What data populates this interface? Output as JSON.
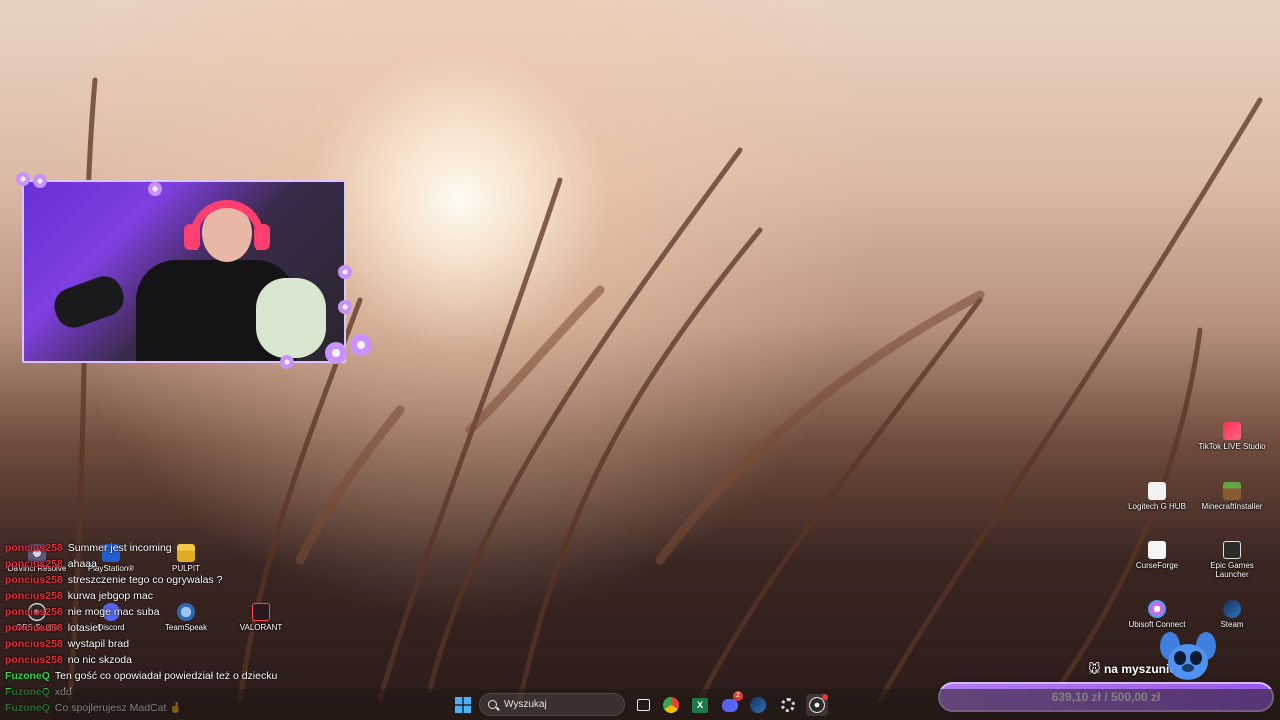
{
  "chat": [
    {
      "user": "poncius258",
      "user_color": "red",
      "message": "Summer jest incoming"
    },
    {
      "user": "poncius258",
      "user_color": "red",
      "message": "ahaaa"
    },
    {
      "user": "poncius258",
      "user_color": "red",
      "message": "streszczenie tego co ogrywalas ?"
    },
    {
      "user": "poncius258",
      "user_color": "red",
      "message": "kurwa jebgop mac"
    },
    {
      "user": "poncius258",
      "user_color": "red",
      "message": "nie moge mac suba"
    },
    {
      "user": "poncius258",
      "user_color": "red",
      "message": "lotasiet"
    },
    {
      "user": "poncius258",
      "user_color": "red",
      "message": "wystapil brad"
    },
    {
      "user": "poncius258",
      "user_color": "red",
      "message": "no nic skzoda"
    },
    {
      "user": "FuzoneQ",
      "user_color": "green",
      "message": "Ten gość co opowiadał powiedział też o dziecku"
    },
    {
      "user": "FuzoneQ",
      "user_color": "green",
      "message": "xdd"
    },
    {
      "user": "FuzoneQ",
      "user_color": "green",
      "message": "Co spojlerujesz MadCat 🤞"
    }
  ],
  "desktop_icons": {
    "davinci": "DaVinci Resolve",
    "playstation": "PlayStation®",
    "pulpit": "PULPIT",
    "obs": "OBS Studio",
    "discord": "Discord",
    "teamspeak": "TeamSpeak",
    "valorant": "VALORANT",
    "tiktok": "TikTok LIVE Studio",
    "logitech": "Logitech G HUB",
    "minecraft": "MinecraftInstaller",
    "curseforge": "CurseForge",
    "epic": "Epic Games Launcher",
    "ubisoft": "Ubisoft Connect",
    "steam": "Steam"
  },
  "donation": {
    "title": "🐭 na myszunie 🐭",
    "progress_text": "639,10 zł / 500,00 zł",
    "current": 639.1,
    "goal": 500.0
  },
  "taskbar": {
    "search_placeholder": "Wyszukaj",
    "discord_badge": "2"
  },
  "colors": {
    "chat_red": "#e0303a",
    "chat_green": "#3bd14a",
    "donation_accent": "#a66bee",
    "webcam_border": "#d7c6ff"
  }
}
